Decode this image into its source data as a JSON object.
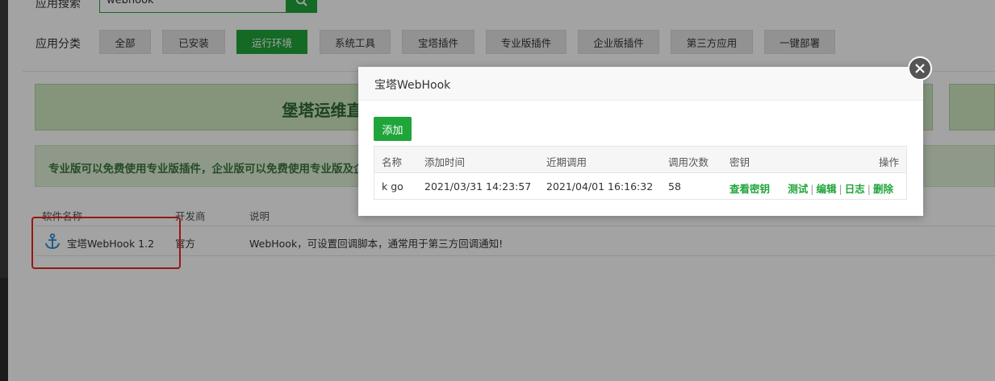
{
  "search": {
    "label": "应用搜索",
    "value": "webhook"
  },
  "categories": {
    "label": "应用分类",
    "items": [
      "全部",
      "已安装",
      "运行环境",
      "系统工具",
      "宝塔插件",
      "专业版插件",
      "企业版插件",
      "第三方应用",
      "一键部署"
    ],
    "active_index": 2
  },
  "banner": {
    "text": "堡塔运维直播答疑"
  },
  "notice": {
    "text": "专业版可以免费使用专业版插件，企业版可以免费使用专业版及企业"
  },
  "plugin_table": {
    "headers": [
      "软件名称",
      "开发商",
      "说明"
    ],
    "row": {
      "name": "宝塔WebHook 1.2",
      "vendor": "官方",
      "desc": "WebHook，可设置回调脚本，通常用于第三方回调通知!"
    }
  },
  "modal": {
    "title": "宝塔WebHook",
    "add_label": "添加",
    "headers": [
      "名称",
      "添加时间",
      "近期调用",
      "调用次数",
      "密钥",
      "操作"
    ],
    "row": {
      "name": "k go",
      "added": "2021/03/31 14:23:57",
      "last_call": "2021/04/01 16:16:32",
      "count": "58",
      "key_link": "查看密钥",
      "actions": [
        "测试",
        "编辑",
        "日志",
        "删除"
      ]
    }
  },
  "colors": {
    "accent": "#20a53a",
    "highlight": "#e8281f"
  }
}
